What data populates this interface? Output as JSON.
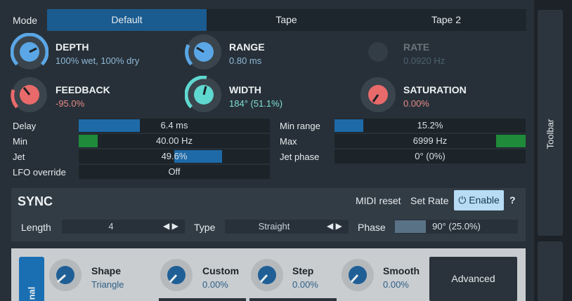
{
  "mode": {
    "label": "Mode",
    "tabs": [
      "Default",
      "Tape",
      "Tape 2"
    ],
    "active": 0
  },
  "knobs": {
    "depth": {
      "name": "DEPTH",
      "value": "100% wet, 100% dry"
    },
    "range": {
      "name": "RANGE",
      "value": "0.80 ms"
    },
    "rate": {
      "name": "RATE",
      "value": "0.0920 Hz"
    },
    "feedback": {
      "name": "FEEDBACK",
      "value": "-95.0%"
    },
    "width": {
      "name": "WIDTH",
      "value": "184° (51.1%)"
    },
    "saturation": {
      "name": "SATURATION",
      "value": "0.00%"
    }
  },
  "params": {
    "delay": {
      "label": "Delay",
      "value": "6.4 ms",
      "level": 0.32
    },
    "min": {
      "label": "Min",
      "value": "40.00 Hz",
      "level": 0.1
    },
    "jet": {
      "label": "Jet",
      "value": "49.6%",
      "level": 0.496
    },
    "lfo_override": {
      "label": "LFO override",
      "value": "Off"
    },
    "min_range": {
      "label": "Min range",
      "value": "15.2%",
      "level": 0.152
    },
    "max": {
      "label": "Max",
      "value": "6999 Hz",
      "level": 0.84
    },
    "jet_phase": {
      "label": "Jet phase",
      "value": "0° (0%)"
    }
  },
  "sync": {
    "title": "SYNC",
    "midi_reset": "MIDI reset",
    "set_rate": "Set Rate",
    "enable": "Enable",
    "help": "?",
    "length_label": "Length",
    "length_value": "4",
    "type_label": "Type",
    "type_value": "Straight",
    "phase_label": "Phase",
    "phase_value": "90° (25.0%)",
    "phase_level": 0.25
  },
  "lfo": {
    "side_tab": "nal",
    "shape": {
      "name": "Shape",
      "value": "Triangle"
    },
    "custom": {
      "name": "Custom",
      "value": "0.00%"
    },
    "step": {
      "name": "Step",
      "value": "0.00%"
    },
    "smooth": {
      "name": "Smooth",
      "value": "0.00%"
    },
    "advanced": "Advanced"
  },
  "toolbar": {
    "label": "Toolbar"
  },
  "colors": {
    "accent": "#1a5b90",
    "knob_blue": "#5aa6e6",
    "knob_red": "#e86a6a",
    "knob_teal": "#5fd8d0",
    "enable_bg": "#b7dcf4"
  }
}
